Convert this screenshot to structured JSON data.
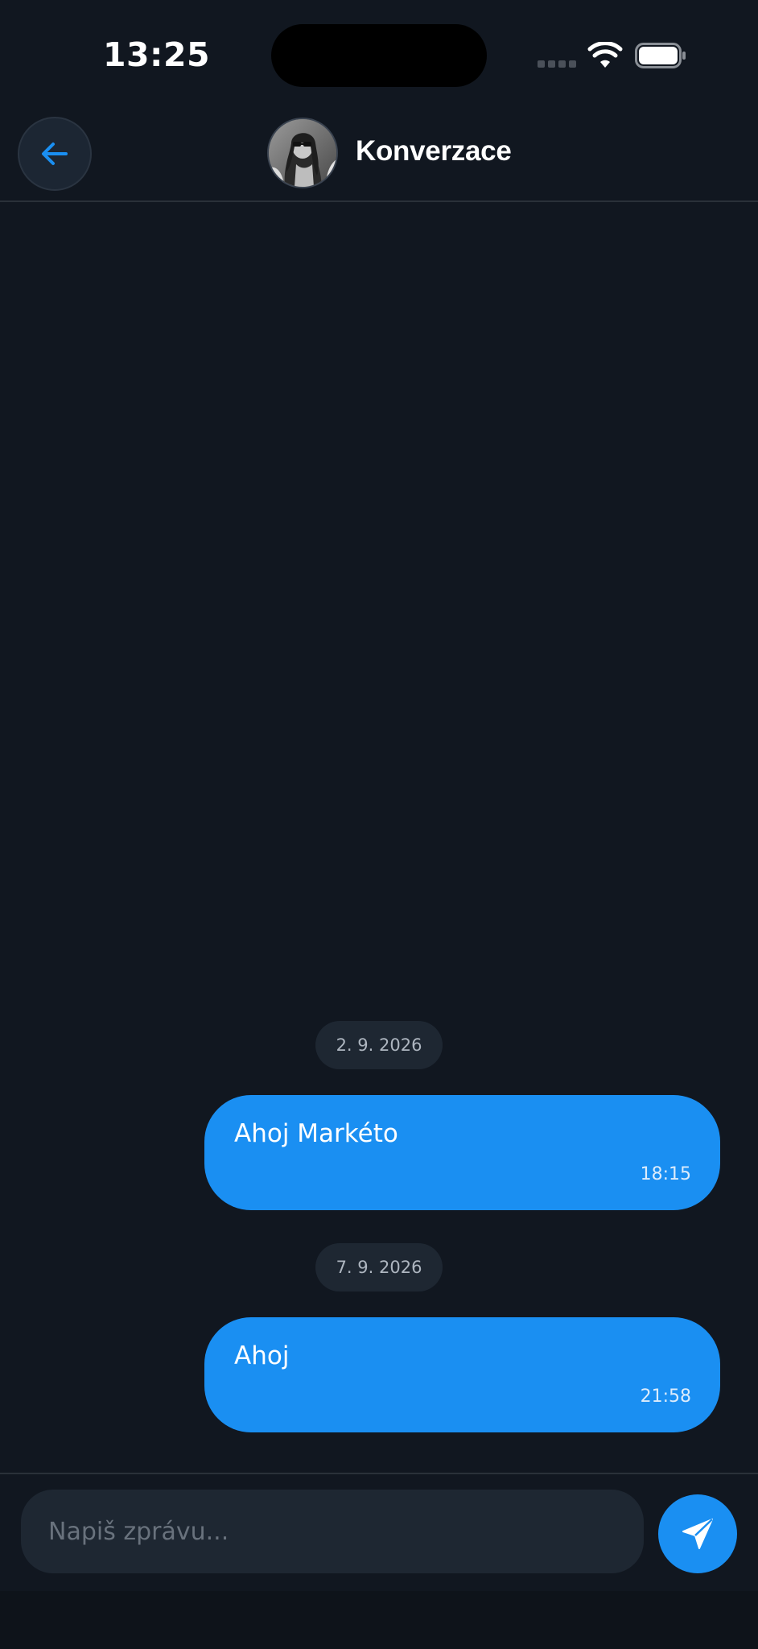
{
  "status_bar": {
    "time": "13:25",
    "wifi_icon": "wifi-icon",
    "battery_icon": "battery-icon"
  },
  "header": {
    "title": "Konverzace",
    "back_icon": "arrow-left-icon"
  },
  "conversation": [
    {
      "date": "2. 9. 2026",
      "text": "Ahoj Markéto",
      "time": "18:15"
    },
    {
      "date": "7. 9. 2026",
      "text": "Ahoj",
      "time": "21:58"
    }
  ],
  "composer": {
    "placeholder": "Napiš zprávu...",
    "value": "",
    "send_icon": "send-icon"
  },
  "colors": {
    "background": "#111720",
    "accent": "#1a8ff2",
    "surface": "#1e2732"
  }
}
